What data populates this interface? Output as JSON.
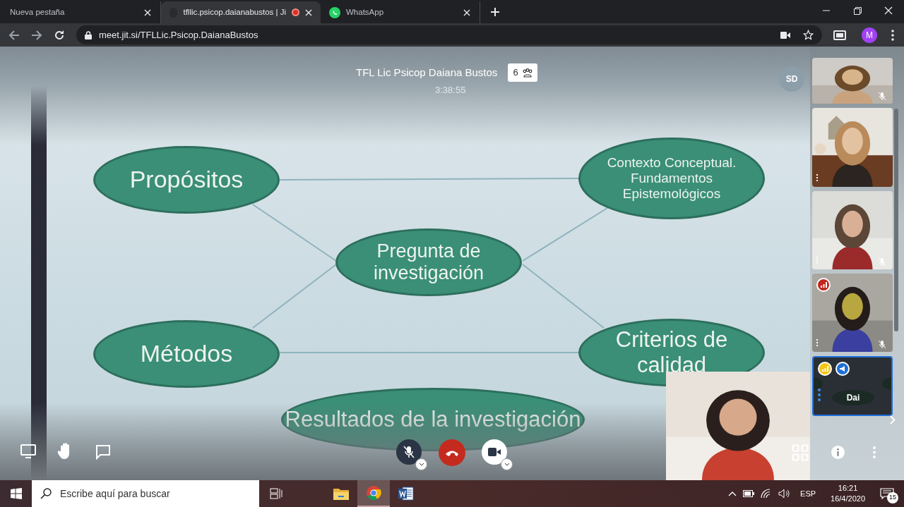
{
  "browser": {
    "tabs": [
      {
        "title": "Nueva pestaña",
        "selected": false,
        "recording": false
      },
      {
        "title": "tfllic.psicop.daianabustos | Ji",
        "selected": true,
        "recording": true
      },
      {
        "title": "WhatsApp",
        "selected": false,
        "recording": false
      }
    ],
    "address": "meet.jit.si/TFLLic.Psicop.DaianaBustos",
    "profile": "M"
  },
  "meeting": {
    "title": "TFL Lic Psicop Daiana Bustos",
    "participants": "6",
    "timer": "3:38:55",
    "speaker_avatar": "SD"
  },
  "slide": {
    "nodes": [
      {
        "text": "Propósitos"
      },
      {
        "text": "Contexto Conceptual.\nFundamentos\nEpistemológicos"
      },
      {
        "text": "Pregunta de\ninvestigación"
      },
      {
        "text": "Métodos"
      },
      {
        "text": "Criterios de\ncalidad"
      },
      {
        "text": "Resultados de la investigación"
      }
    ]
  },
  "toolbar": {
    "mic_muted": true,
    "camera_on": true
  },
  "filmstrip": {
    "tiles": [
      {
        "kind": "remote",
        "muted": true,
        "menu": false
      },
      {
        "kind": "remote",
        "muted": false,
        "menu": true
      },
      {
        "kind": "remote",
        "muted": true,
        "menu": true
      },
      {
        "kind": "remote",
        "muted": true,
        "menu": true,
        "badges": [
          {
            "kind": "signal",
            "color": "#c0281f"
          }
        ]
      },
      {
        "kind": "local",
        "name": "Dai",
        "badges": [
          {
            "kind": "signal",
            "color": "#f5c518"
          },
          {
            "kind": "speaker",
            "color": "#1e6fd9"
          }
        ]
      }
    ]
  },
  "taskbar": {
    "search_placeholder": "Escribe aquí para buscar",
    "language": "ESP",
    "time": "16:21",
    "date": "16/4/2020",
    "notifications": "15"
  }
}
